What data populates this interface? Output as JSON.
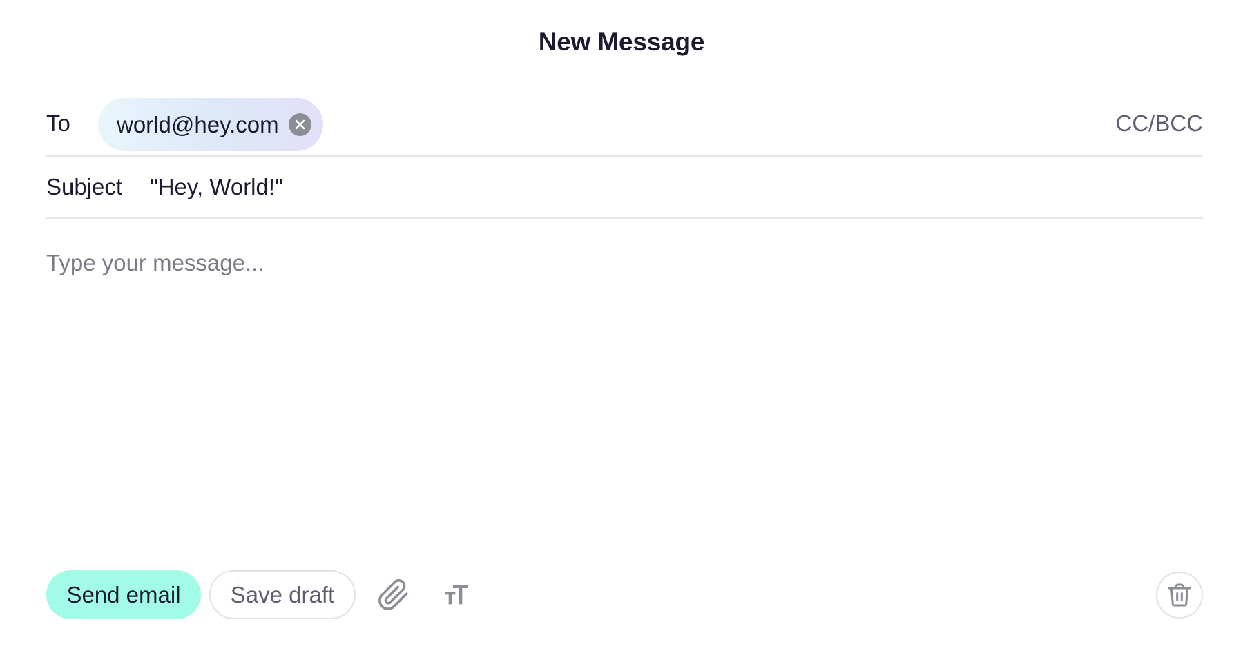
{
  "header": {
    "title": "New Message"
  },
  "to": {
    "label": "To",
    "recipients": [
      {
        "email": "world@hey.com"
      }
    ],
    "cc_bcc_label": "CC/BCC"
  },
  "subject": {
    "label": "Subject",
    "value": "\"Hey, World!\""
  },
  "body": {
    "value": "",
    "placeholder": "Type your message..."
  },
  "toolbar": {
    "send_label": "Send email",
    "draft_label": "Save draft",
    "icons": {
      "attach": "paperclip-icon",
      "text_format": "text-size-icon",
      "delete": "trash-icon",
      "remove_recipient": "close-icon"
    }
  },
  "colors": {
    "accent": "#a2fbe6",
    "text": "#1c1a2e",
    "muted": "#5f5e70",
    "icon": "#8c8e96",
    "divider": "#e6e6e8"
  }
}
